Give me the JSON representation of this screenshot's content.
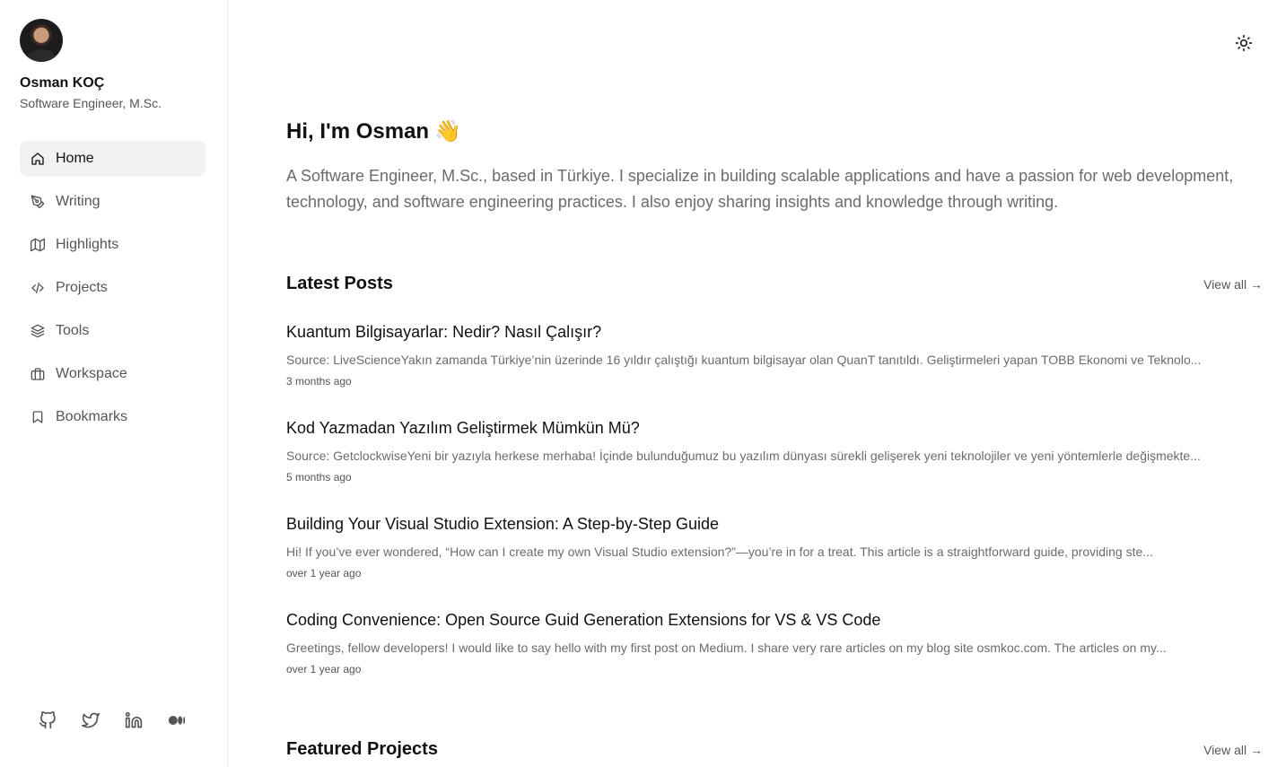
{
  "profile": {
    "name": "Osman KOÇ",
    "title": "Software Engineer, M.Sc."
  },
  "nav": [
    {
      "label": "Home",
      "icon": "home-icon",
      "active": true
    },
    {
      "label": "Writing",
      "icon": "pen-icon",
      "active": false
    },
    {
      "label": "Highlights",
      "icon": "map-icon",
      "active": false
    },
    {
      "label": "Projects",
      "icon": "code-icon",
      "active": false
    },
    {
      "label": "Tools",
      "icon": "layers-icon",
      "active": false
    },
    {
      "label": "Workspace",
      "icon": "briefcase-icon",
      "active": false
    },
    {
      "label": "Bookmarks",
      "icon": "bookmark-icon",
      "active": false
    }
  ],
  "socials": [
    "github-icon",
    "twitter-icon",
    "linkedin-icon",
    "medium-icon"
  ],
  "header": {
    "theme_toggle_icon": "sun-icon"
  },
  "hero": {
    "greeting": "Hi, I'm Osman",
    "wave": "👋",
    "intro": "A Software Engineer, M.Sc., based in Türkiye. I specialize in building scalable applications and have a passion for web development, technology, and software engineering practices. I also enjoy sharing insights and knowledge through writing."
  },
  "latest_posts": {
    "title": "Latest Posts",
    "view_all": "View all →",
    "items": [
      {
        "title": "Kuantum Bilgisayarlar: Nedir? Nasıl Çalışır?",
        "excerpt": "Source: LiveScienceYakın zamanda Türkiye’nin üzerinde 16 yıldır çalıştığı kuantum bilgisayar olan QuanT tanıtıldı. Geliştirmeleri yapan TOBB Ekonomi ve Teknolo...",
        "date": "3 months ago"
      },
      {
        "title": "Kod Yazmadan Yazılım Geliştirmek Mümkün Mü?",
        "excerpt": "Source: GetclockwiseYeni bir yazıyla herkese merhaba! İçinde bulunduğumuz bu yazılım dünyası sürekli gelişerek yeni teknolojiler ve yeni yöntemlerle değişmekte...",
        "date": "5 months ago"
      },
      {
        "title": "Building Your Visual Studio Extension: A Step-by-Step Guide",
        "excerpt": "Hi! If you’ve ever wondered, “How can I create my own Visual Studio extension?”—you’re in for a treat. This article is a straightforward guide, providing ste...",
        "date": "over 1 year ago"
      },
      {
        "title": "Coding Convenience: Open Source Guid Generation Extensions for VS & VS Code",
        "excerpt": "Greetings, fellow developers! I would like to say hello with my first post on Medium. I share very rare articles on my blog site osmkoc.com. The articles on my...",
        "date": "over 1 year ago"
      }
    ]
  },
  "featured_projects": {
    "title": "Featured Projects",
    "view_all": "View all →"
  }
}
